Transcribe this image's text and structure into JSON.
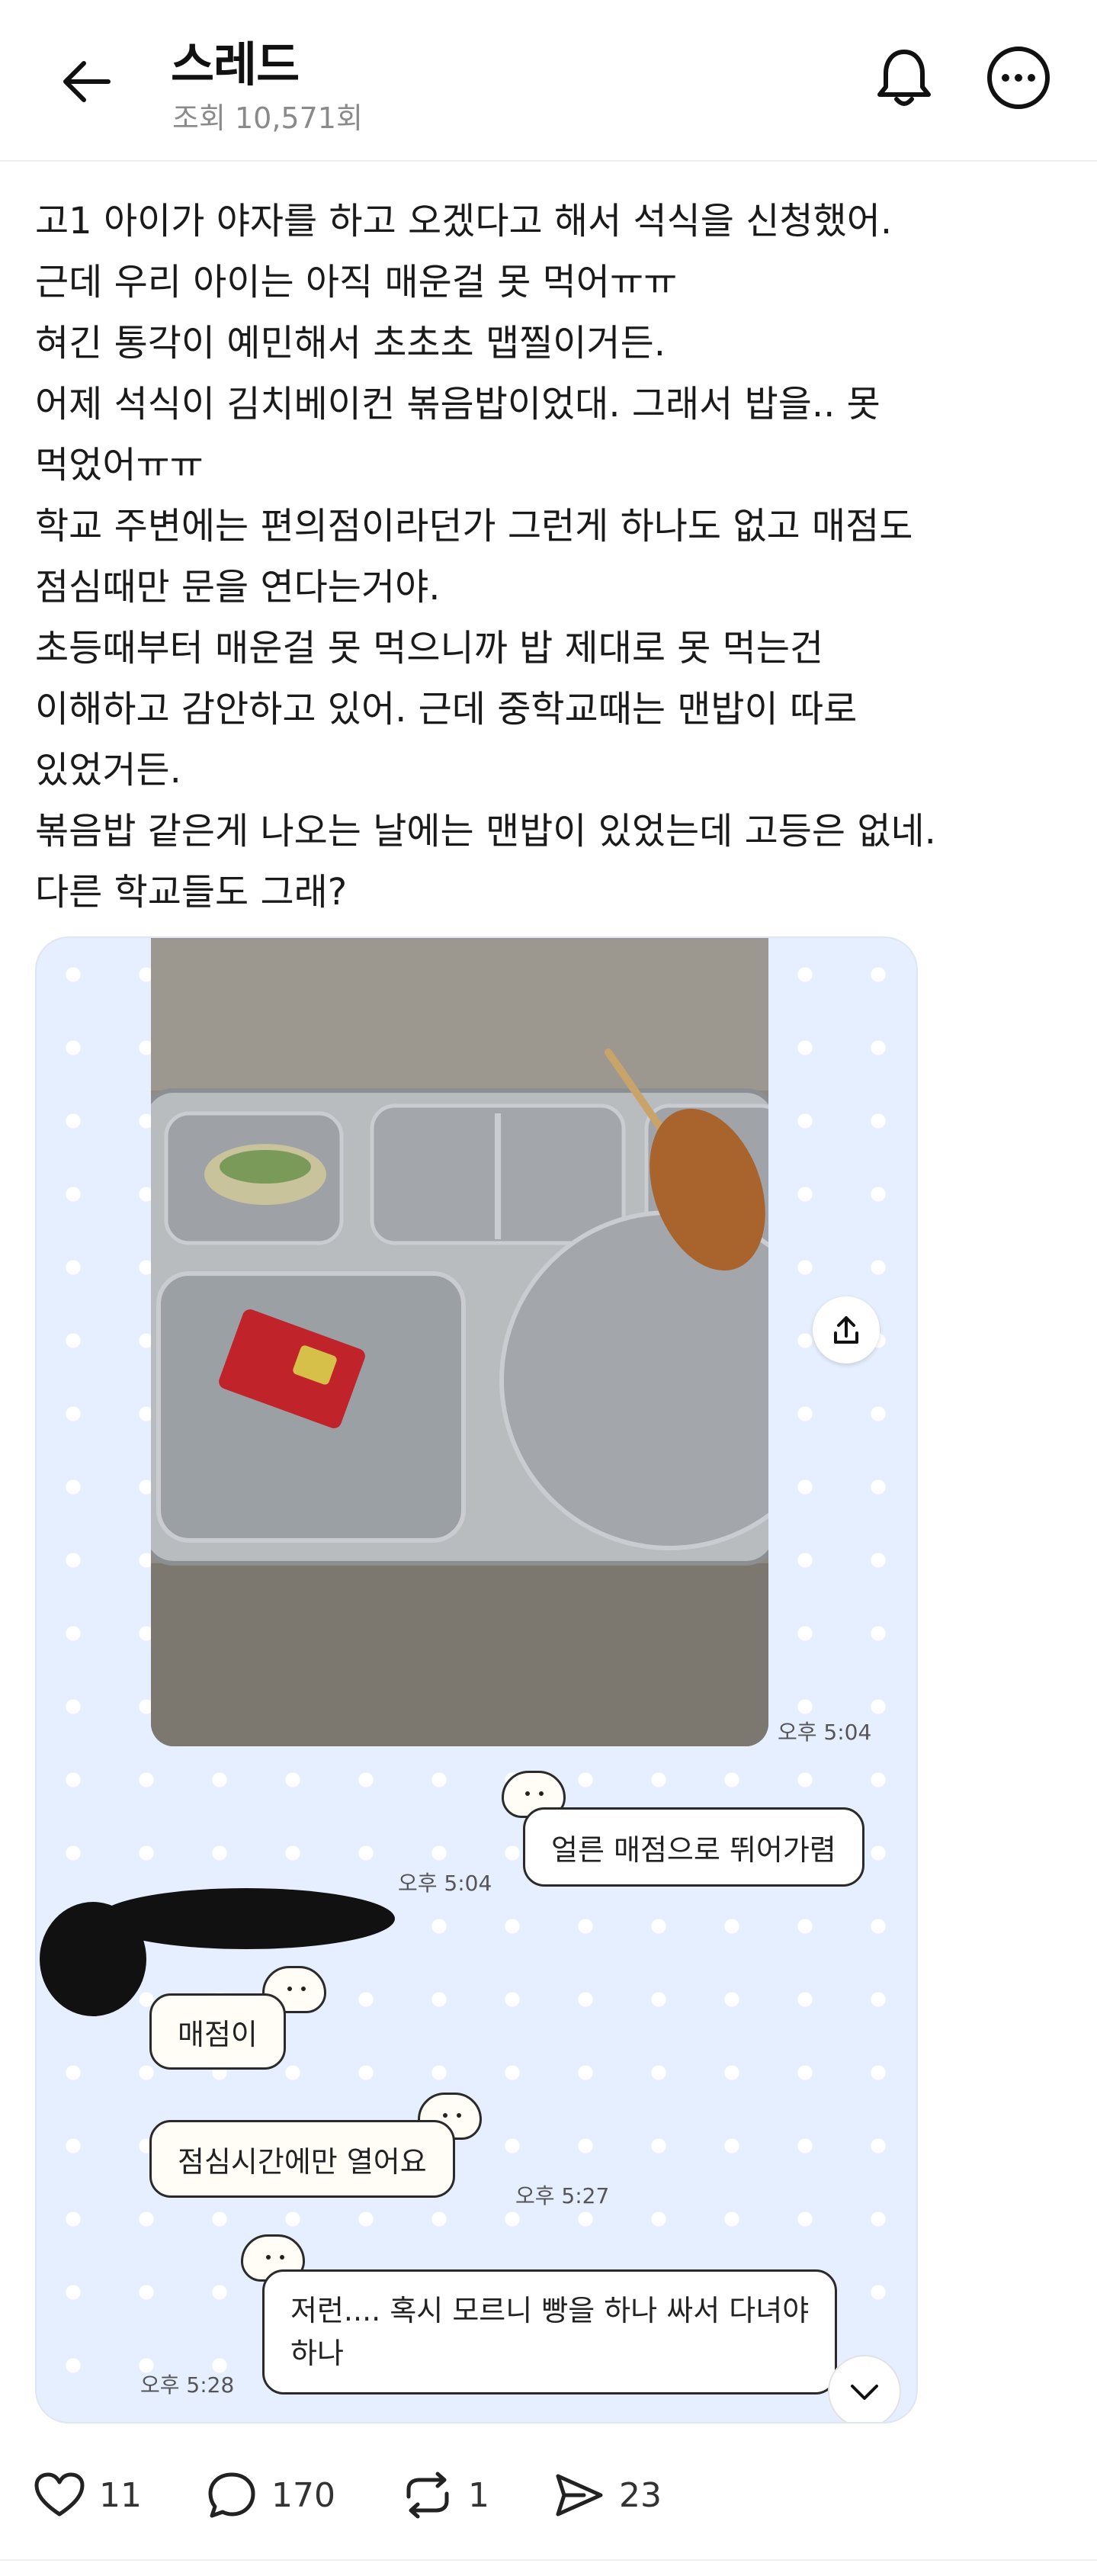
{
  "header": {
    "title": "스레드",
    "views": "조회 10,571회"
  },
  "post": {
    "lines": [
      "고1 아이가 야자를 하고 오겠다고 해서 석식을 신청했어.",
      "근데 우리 아이는 아직 매운걸 못 먹어ㅠㅠ",
      "혀긴 통각이 예민해서 초초초 맵찔이거든.",
      "어제 석식이 김치베이컨 볶음밥이었대. 그래서 밥을.. 못",
      "먹었어ㅠㅠ",
      "학교 주변에는 편의점이라던가 그런게 하나도 없고 매점도",
      "점심때만 문을 연다는거야.",
      "초등때부터 매운걸 못 먹으니까 밥 제대로 못 먹는건",
      "이해하고 감안하고 있어. 근데 중학교때는 맨밥이 따로",
      "있었거든.",
      "볶음밥 같은게 나오는 날에는 맨밥이 있었는데 고등은 없네.",
      "다른 학교들도 그래?"
    ]
  },
  "chat": {
    "photo_time": "오후 5:04",
    "messages": [
      {
        "side": "right",
        "text": "얼른 매점으로 뛰어가렴",
        "time": "오후 5:04"
      },
      {
        "side": "left",
        "text": "매점이",
        "time": ""
      },
      {
        "side": "left",
        "text": "점심시간에만 열어요",
        "time": "오후 5:27"
      },
      {
        "side": "right",
        "text": "저런.... 혹시 모르니 빵을 하나 싸서 다녀야",
        "text2": "하나",
        "time": "오후 5:28"
      }
    ]
  },
  "actions": {
    "likes": "11",
    "replies": "170",
    "reposts": "1",
    "shares": "23"
  },
  "colors": {
    "card_bg": "#e6efff",
    "bubble_border": "#2a2a2a"
  }
}
